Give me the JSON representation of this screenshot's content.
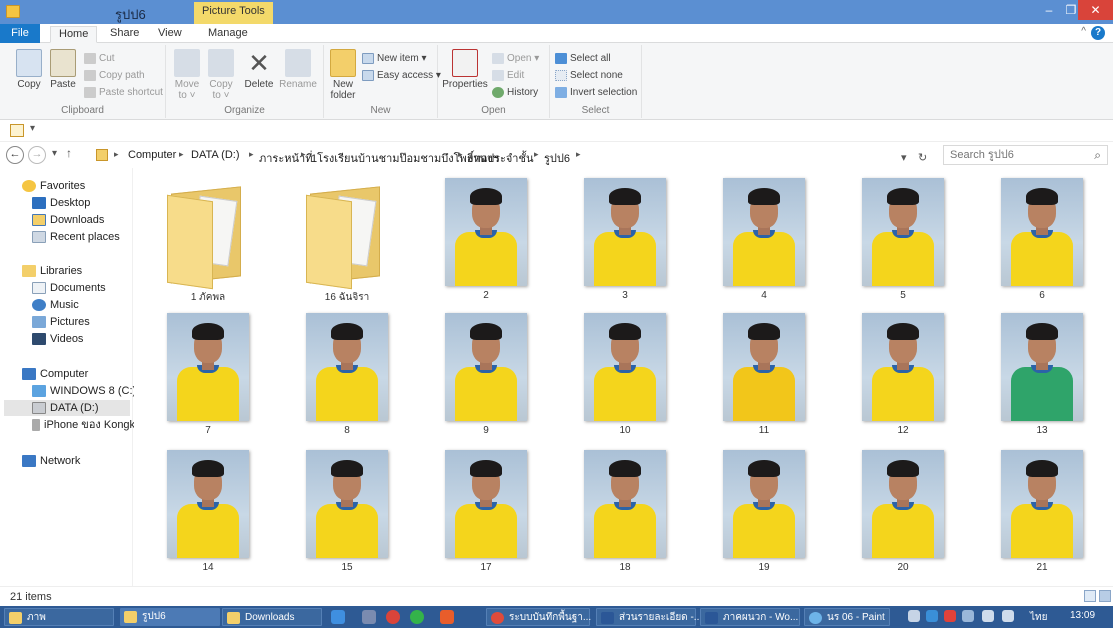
{
  "window": {
    "title": "รูปป6",
    "context_tab": "Picture Tools",
    "controls": [
      "–",
      "❐",
      "✕"
    ]
  },
  "ribbon_tabs": {
    "file": "File",
    "home": "Home",
    "share": "Share",
    "view": "View",
    "manage": "Manage"
  },
  "ribbon": {
    "clipboard": {
      "label": "Clipboard",
      "copy": "Copy",
      "paste": "Paste",
      "cut": "Cut",
      "copy_path": "Copy path",
      "paste_shortcut": "Paste shortcut"
    },
    "organize": {
      "label": "Organize",
      "move_to": "Move to ˅",
      "copy_to": "Copy to ˅",
      "delete": "Delete",
      "rename": "Rename"
    },
    "new": {
      "label": "New",
      "new_folder": "New folder",
      "new_item": "New item ▾",
      "easy_access": "Easy access ▾"
    },
    "open": {
      "label": "Open",
      "properties": "Properties",
      "open": "Open ▾",
      "edit": "Edit",
      "history": "History"
    },
    "select": {
      "label": "Select",
      "select_all": "Select all",
      "select_none": "Select none",
      "invert_selection": "Invert selection"
    }
  },
  "qat": {
    "dropdown": "▾"
  },
  "nav": {
    "back": "←",
    "forward": "→",
    "recent": "▾",
    "up": "↑",
    "breadcrumbs": [
      "Computer",
      "DATA (D:)",
      "ภาระหน้าที่",
      "1โรงเรียนบ้านชามป๊อมชามบึงโพธิ์ทองฯ",
      "งานประจำชั้น",
      "รูปป6"
    ],
    "refresh": "↻",
    "dropdown": "▾",
    "search_placeholder": "Search รูปป6"
  },
  "sidebar": {
    "favorites": "Favorites",
    "desktop": "Desktop",
    "downloads": "Downloads",
    "recent_places": "Recent places",
    "libraries": "Libraries",
    "documents": "Documents",
    "music": "Music",
    "pictures": "Pictures",
    "videos": "Videos",
    "computer": "Computer",
    "windows8": "WINDOWS 8 (C:)",
    "data_d": "DATA (D:)",
    "iphone": "iPhone ของ Kongka",
    "network": "Network"
  },
  "items": [
    {
      "label": "1 ภัคพล",
      "kind": "folder"
    },
    {
      "label": "16 ฉันจิรา",
      "kind": "folder"
    },
    {
      "label": "2",
      "kind": "photo",
      "shirt": "#f4d51c"
    },
    {
      "label": "3",
      "kind": "photo",
      "shirt": "#f4d51c"
    },
    {
      "label": "4",
      "kind": "photo",
      "shirt": "#f4d51c"
    },
    {
      "label": "5",
      "kind": "photo",
      "shirt": "#f4d51c"
    },
    {
      "label": "6",
      "kind": "photo",
      "shirt": "#f4d51c"
    },
    {
      "label": "7",
      "kind": "photo",
      "shirt": "#f4d51c"
    },
    {
      "label": "8",
      "kind": "photo",
      "shirt": "#f4d51c"
    },
    {
      "label": "9",
      "kind": "photo",
      "shirt": "#f4d51c"
    },
    {
      "label": "10",
      "kind": "photo",
      "shirt": "#f4d51c"
    },
    {
      "label": "11",
      "kind": "photo",
      "shirt": "#f2c61a"
    },
    {
      "label": "12",
      "kind": "photo",
      "shirt": "#f4d51c"
    },
    {
      "label": "13",
      "kind": "photo",
      "shirt": "#2fa46a"
    },
    {
      "label": "14",
      "kind": "photo",
      "shirt": "#f4d51c"
    },
    {
      "label": "15",
      "kind": "photo",
      "shirt": "#f4d51c"
    },
    {
      "label": "17",
      "kind": "photo",
      "shirt": "#f4d51c"
    },
    {
      "label": "18",
      "kind": "photo",
      "shirt": "#f4d51c"
    },
    {
      "label": "19",
      "kind": "photo",
      "shirt": "#f4d51c"
    },
    {
      "label": "20",
      "kind": "photo",
      "shirt": "#f4d51c"
    },
    {
      "label": "21",
      "kind": "photo",
      "shirt": "#f4d51c"
    }
  ],
  "status": {
    "count": "21 items"
  },
  "taskbar": {
    "items": [
      "ภาพ",
      "รูปป6",
      "Downloads",
      "ระบบบันทึกพื้นฐา...",
      "ส่วนรายละเอียด -...",
      "ภาคผนวก - Wo...",
      "นร 06 - Paint"
    ],
    "lang": "ไทย",
    "time": "13:09"
  },
  "colors": {
    "titlebar": "#5b8fd2",
    "file_tab": "#1979ca",
    "taskbar": "#2e5a94",
    "context_tab": "#f3d96a",
    "close": "#d9443a"
  }
}
